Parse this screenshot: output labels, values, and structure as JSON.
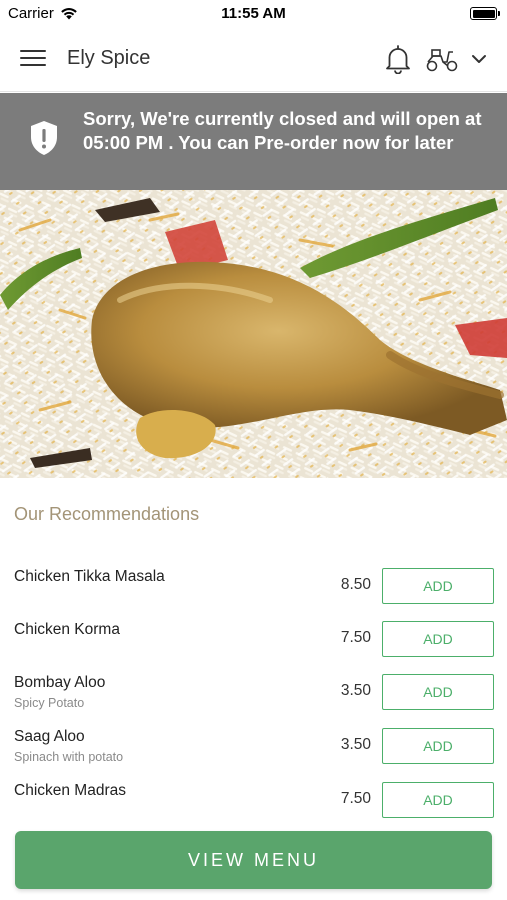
{
  "status_bar": {
    "carrier": "Carrier",
    "time": "11:55 AM"
  },
  "nav": {
    "title": "Ely Spice",
    "icons": [
      "menu-icon",
      "bell-icon",
      "scooter-icon",
      "chevron-down-icon"
    ]
  },
  "banner": {
    "message": "Sorry, We're currently closed and will open at 05:00 PM . You can Pre-order now for later",
    "icon": "shield-alert-icon",
    "background": "#7c7c7c"
  },
  "hero": {
    "image": "chicken-biryani-photo"
  },
  "recommendations": {
    "title": "Our Recommendations",
    "add_label": "ADD",
    "items": [
      {
        "name": "Chicken Tikka Masala",
        "description": "",
        "price": "8.50"
      },
      {
        "name": "Chicken Korma",
        "description": "",
        "price": "7.50"
      },
      {
        "name": "Bombay Aloo",
        "description": "Spicy Potato",
        "price": "3.50"
      },
      {
        "name": "Saag Aloo",
        "description": "Spinach with potato",
        "price": "3.50"
      },
      {
        "name": "Chicken Madras",
        "description": "",
        "price": "7.50"
      }
    ]
  },
  "footer": {
    "view_menu_label": "VIEW MENU",
    "accent": "#5aa56c"
  }
}
